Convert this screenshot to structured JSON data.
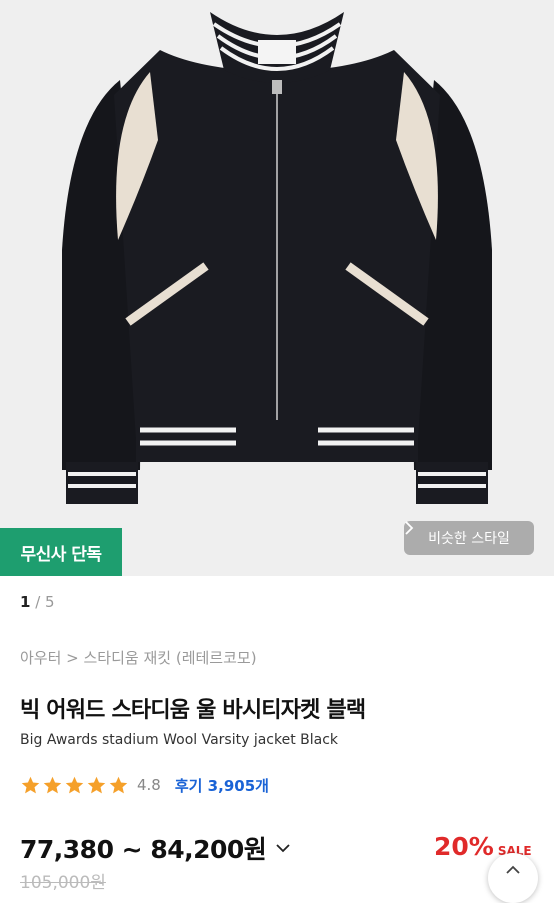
{
  "hero": {
    "badge_label": "무신사 단독",
    "similar_style_label": "비슷한 스타일"
  },
  "gallery": {
    "current": "1",
    "separator": " / ",
    "total": "5"
  },
  "product": {
    "breadcrumb": "아우터 > 스타디움 재킷 (레테르코모)",
    "title_ko": "빅 어워드 스타디움 울 바시티자켓 블랙",
    "title_en": "Big Awards stadium Wool Varsity jacket Black",
    "rating": {
      "stars": 4.8,
      "score_text": "4.8",
      "reviews_text": "후기 3,905개"
    },
    "price_range": "77,380 ~ 84,200원",
    "discount_percent": "20%",
    "sale_label": "SALE",
    "original_price": "105,000원"
  },
  "icons": {
    "similar_chevron": "chevron-right-icon",
    "price_chevron": "chevron-down-icon",
    "scroll_top": "chevron-up-icon",
    "star": "star-icon"
  },
  "colors": {
    "badge_green": "#1e9e6f",
    "review_blue": "#1a63d6",
    "sale_red": "#e02a2a",
    "star_orange": "#f5a02a"
  }
}
